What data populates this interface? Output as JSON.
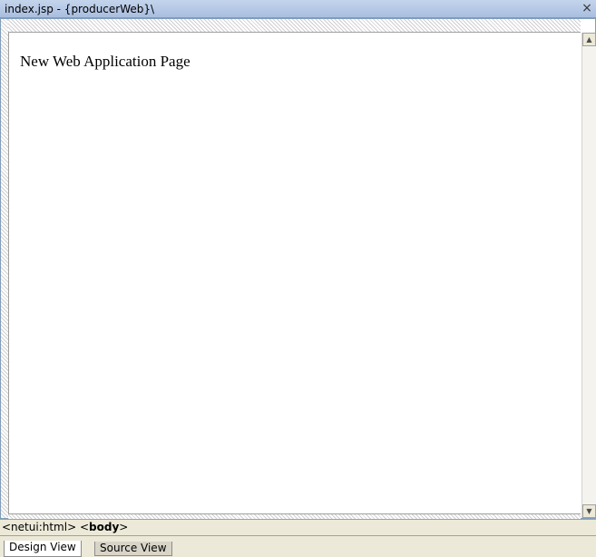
{
  "window": {
    "title": "index.jsp - {producerWeb}\\",
    "close_glyph": "×"
  },
  "canvas": {
    "heading": "New Web Application Page"
  },
  "scrollbar": {
    "up_glyph": "▲",
    "down_glyph": "▼"
  },
  "tag_path": {
    "items": [
      {
        "tag": "<netui:html>"
      },
      {
        "open": "<",
        "name": "body",
        "close": ">"
      }
    ]
  },
  "tabs": [
    {
      "label": "Design View",
      "active": true
    },
    {
      "label": "Source View",
      "active": false
    }
  ]
}
